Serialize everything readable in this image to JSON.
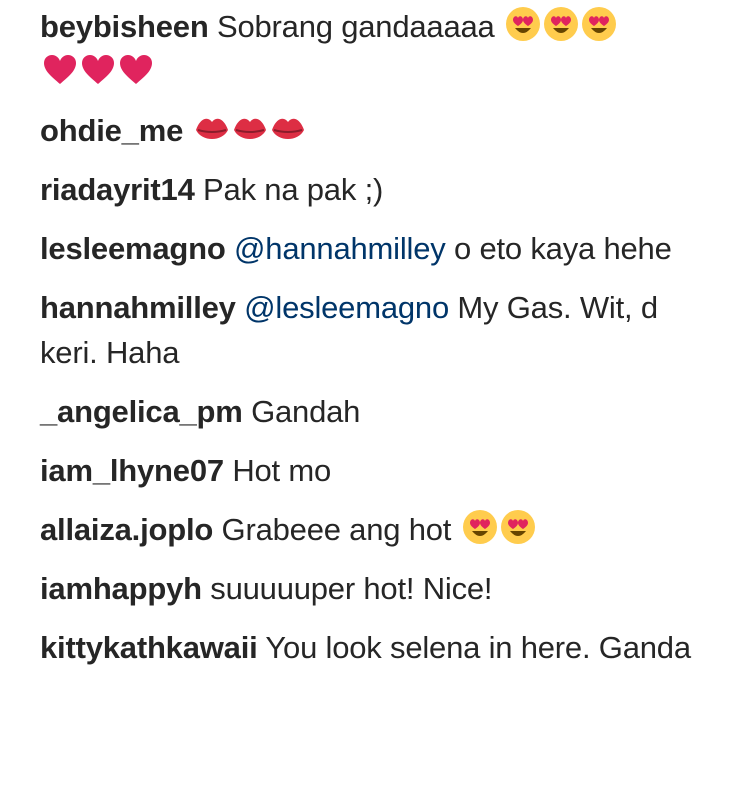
{
  "comments": [
    {
      "user": "beybisheen",
      "text": "Sobrang gandaaaaa",
      "emojis": [
        "heart-eyes",
        "heart-eyes",
        "heart-eyes",
        "red-heart",
        "red-heart",
        "red-heart"
      ]
    },
    {
      "user": "ohdie_me",
      "text": "",
      "emojis": [
        "kiss-lips",
        "kiss-lips",
        "kiss-lips"
      ]
    },
    {
      "user": "riadayrit14",
      "text": "Pak na pak ;)",
      "emojis": []
    },
    {
      "user": "lesleemagno",
      "mention": "@hannahmilley",
      "text": "o eto kaya hehe",
      "emojis": []
    },
    {
      "user": "hannahmilley",
      "mention": "@lesleemagno",
      "text": "My Gas. Wit, d keri. Haha",
      "emojis": []
    },
    {
      "user": "_angelica_pm",
      "text": "Gandah",
      "emojis": []
    },
    {
      "user": "iam_lhyne07",
      "text": "Hot mo",
      "emojis": []
    },
    {
      "user": "allaiza.joplo",
      "text": "Grabeee ang hot",
      "emojis": [
        "heart-eyes",
        "heart-eyes"
      ]
    },
    {
      "user": "iamhappyh",
      "text": "suuuuuper hot! Nice!",
      "emojis": []
    },
    {
      "user": "kittykathkawaii",
      "text": "You look selena in here. Ganda",
      "emojis": []
    }
  ],
  "colors": {
    "text": "#262626",
    "mention": "#003569",
    "emoji_face": "#ffcc4d",
    "heart": "#e0245e",
    "lips": "#dd2e44"
  }
}
